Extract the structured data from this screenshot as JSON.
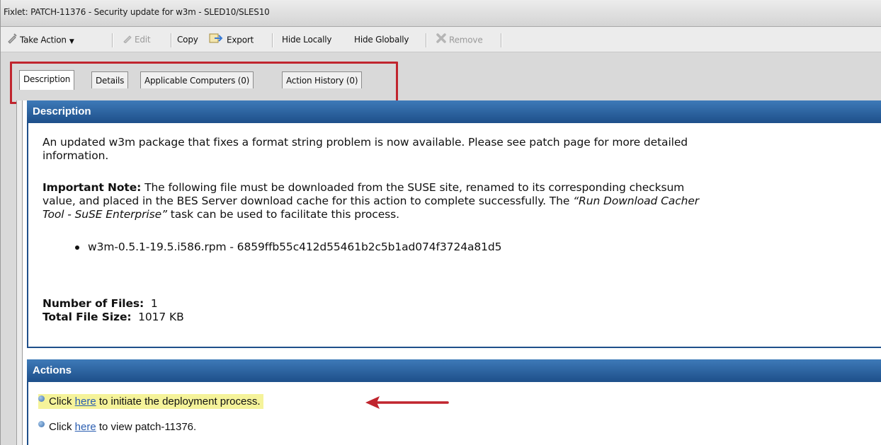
{
  "window": {
    "title": "Fixlet: PATCH-11376 - Security update for w3m - SLED10/SLES10"
  },
  "toolbar": {
    "take_action": "Take Action",
    "edit": "Edit",
    "copy": "Copy",
    "export": "Export",
    "hide_locally": "Hide Locally",
    "hide_globally": "Hide Globally",
    "remove": "Remove"
  },
  "tabs": [
    {
      "label": "Description",
      "active": true
    },
    {
      "label": "Details",
      "active": false
    },
    {
      "label": "Applicable Computers (0)",
      "active": false
    },
    {
      "label": "Action History (0)",
      "active": false
    }
  ],
  "description": {
    "header": "Description",
    "para1_line1": "An updated w3m package that fixes a format string problem is now available. Please see patch page for more detailed",
    "para1_line2": "information.",
    "note_label": "Important Note:",
    "note_line1": " The following file must be downloaded from the SUSE site, renamed to its corresponding checksum",
    "note_line2a": "value, and placed in the BES Server download cache for this action to complete successfully. The ",
    "note_line2b": "“Run Download Cacher",
    "note_line3a": "Tool - SuSE Enterprise”",
    "note_line3b": " task can be used to facilitate this process.",
    "file_item": "w3m-0.5.1-19.5.i586.rpm - 6859ffb55c412d55461b2c5b1ad074f3724a81d5",
    "num_files_label": "Number of Files:",
    "num_files_value": "1",
    "total_size_label": "Total File Size:",
    "total_size_value": "1017 KB"
  },
  "actions": {
    "header": "Actions",
    "item1_before": "Click ",
    "item1_link": "here",
    "item1_after": " to initiate the deployment process.",
    "item2_before": "Click ",
    "item2_link": "here",
    "item2_after": " to view patch-11376."
  },
  "colors": {
    "header_blue": "#1e4f8a",
    "annotation_red": "#c0252e",
    "highlight_yellow": "#f5f39a",
    "link_blue": "#2a5db0"
  }
}
